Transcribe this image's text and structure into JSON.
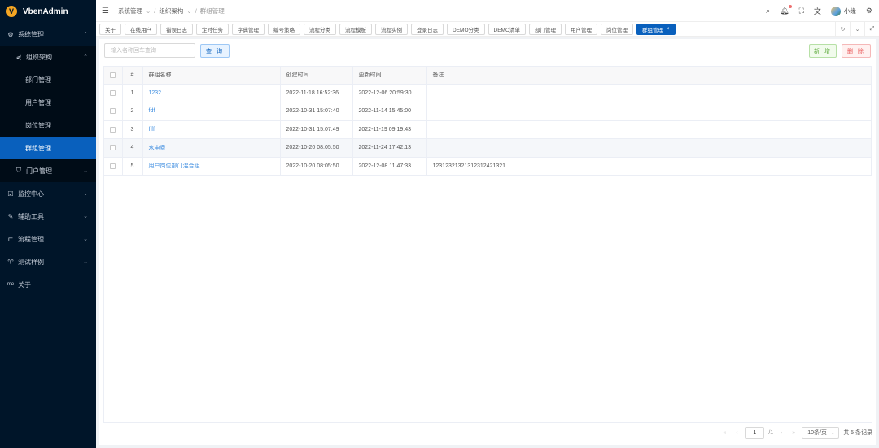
{
  "app": {
    "logo_letter": "V",
    "name": "VbenAdmin"
  },
  "sidebar": {
    "items": [
      {
        "label": "系统管理",
        "icon": "⚙",
        "level": 0,
        "arrow": "⌃"
      },
      {
        "label": "组织架构",
        "icon": "⋞",
        "level": 1,
        "arrow": "⌃"
      },
      {
        "label": "部门管理",
        "level": 2
      },
      {
        "label": "用户管理",
        "level": 2
      },
      {
        "label": "岗位管理",
        "level": 2
      },
      {
        "label": "群组管理",
        "level": 2,
        "active": true
      },
      {
        "label": "门户管理",
        "icon": "⛉",
        "level": 1,
        "arrow": "⌄"
      },
      {
        "label": "监控中心",
        "icon": "☑",
        "level": 0,
        "arrow": "⌄"
      },
      {
        "label": "辅助工具",
        "icon": "✎",
        "level": 0,
        "arrow": "⌄"
      },
      {
        "label": "流程管理",
        "icon": "⊏",
        "level": 0,
        "arrow": "⌄"
      },
      {
        "label": "测试样例",
        "icon": "♈",
        "level": 0,
        "arrow": "⌄"
      },
      {
        "label": "关于",
        "icon": "me",
        "level": 0
      }
    ]
  },
  "header": {
    "breadcrumb": [
      "系统管理",
      "组织架构",
      "群组管理"
    ],
    "user_name": "小缘"
  },
  "tabs": [
    "关于",
    "在线用户",
    "错误日志",
    "定时任务",
    "字典管理",
    "编号策略",
    "流程分类",
    "流程模板",
    "流程实例",
    "登录日志",
    "DEMO分类",
    "DEMO清单",
    "部门管理",
    "用户管理",
    "岗位管理",
    "群组管理"
  ],
  "active_tab": "群组管理",
  "toolbar": {
    "search_placeholder": "输入名称回车查询",
    "query_label": "查 询",
    "add_label": "新 增",
    "delete_label": "删 除"
  },
  "table": {
    "columns": [
      "#",
      "群组名称",
      "创建时间",
      "更新时间",
      "备注"
    ],
    "rows": [
      {
        "no": "1",
        "name": "1232",
        "created": "2022-11-18 16:52:36",
        "updated": "2022-12-06 20:59:30",
        "remark": ""
      },
      {
        "no": "2",
        "name": "fdf",
        "created": "2022-10-31 15:07:40",
        "updated": "2022-11-14 15:45:00",
        "remark": ""
      },
      {
        "no": "3",
        "name": "ffff",
        "created": "2022-10-31 15:07:49",
        "updated": "2022-11-19 09:19:43",
        "remark": ""
      },
      {
        "no": "4",
        "name": "水电费",
        "created": "2022-10-20 08:05:50",
        "updated": "2022-11-24 17:42:13",
        "remark": ""
      },
      {
        "no": "5",
        "name": "用户岗位部门混合组",
        "created": "2022-10-20 08:05:50",
        "updated": "2022-12-08 11:47:33",
        "remark": "1231232132131231242132​1"
      }
    ]
  },
  "pager": {
    "page": "1",
    "total_pages": "/1",
    "page_size": "10条/页",
    "total": "共 5 条记录"
  }
}
